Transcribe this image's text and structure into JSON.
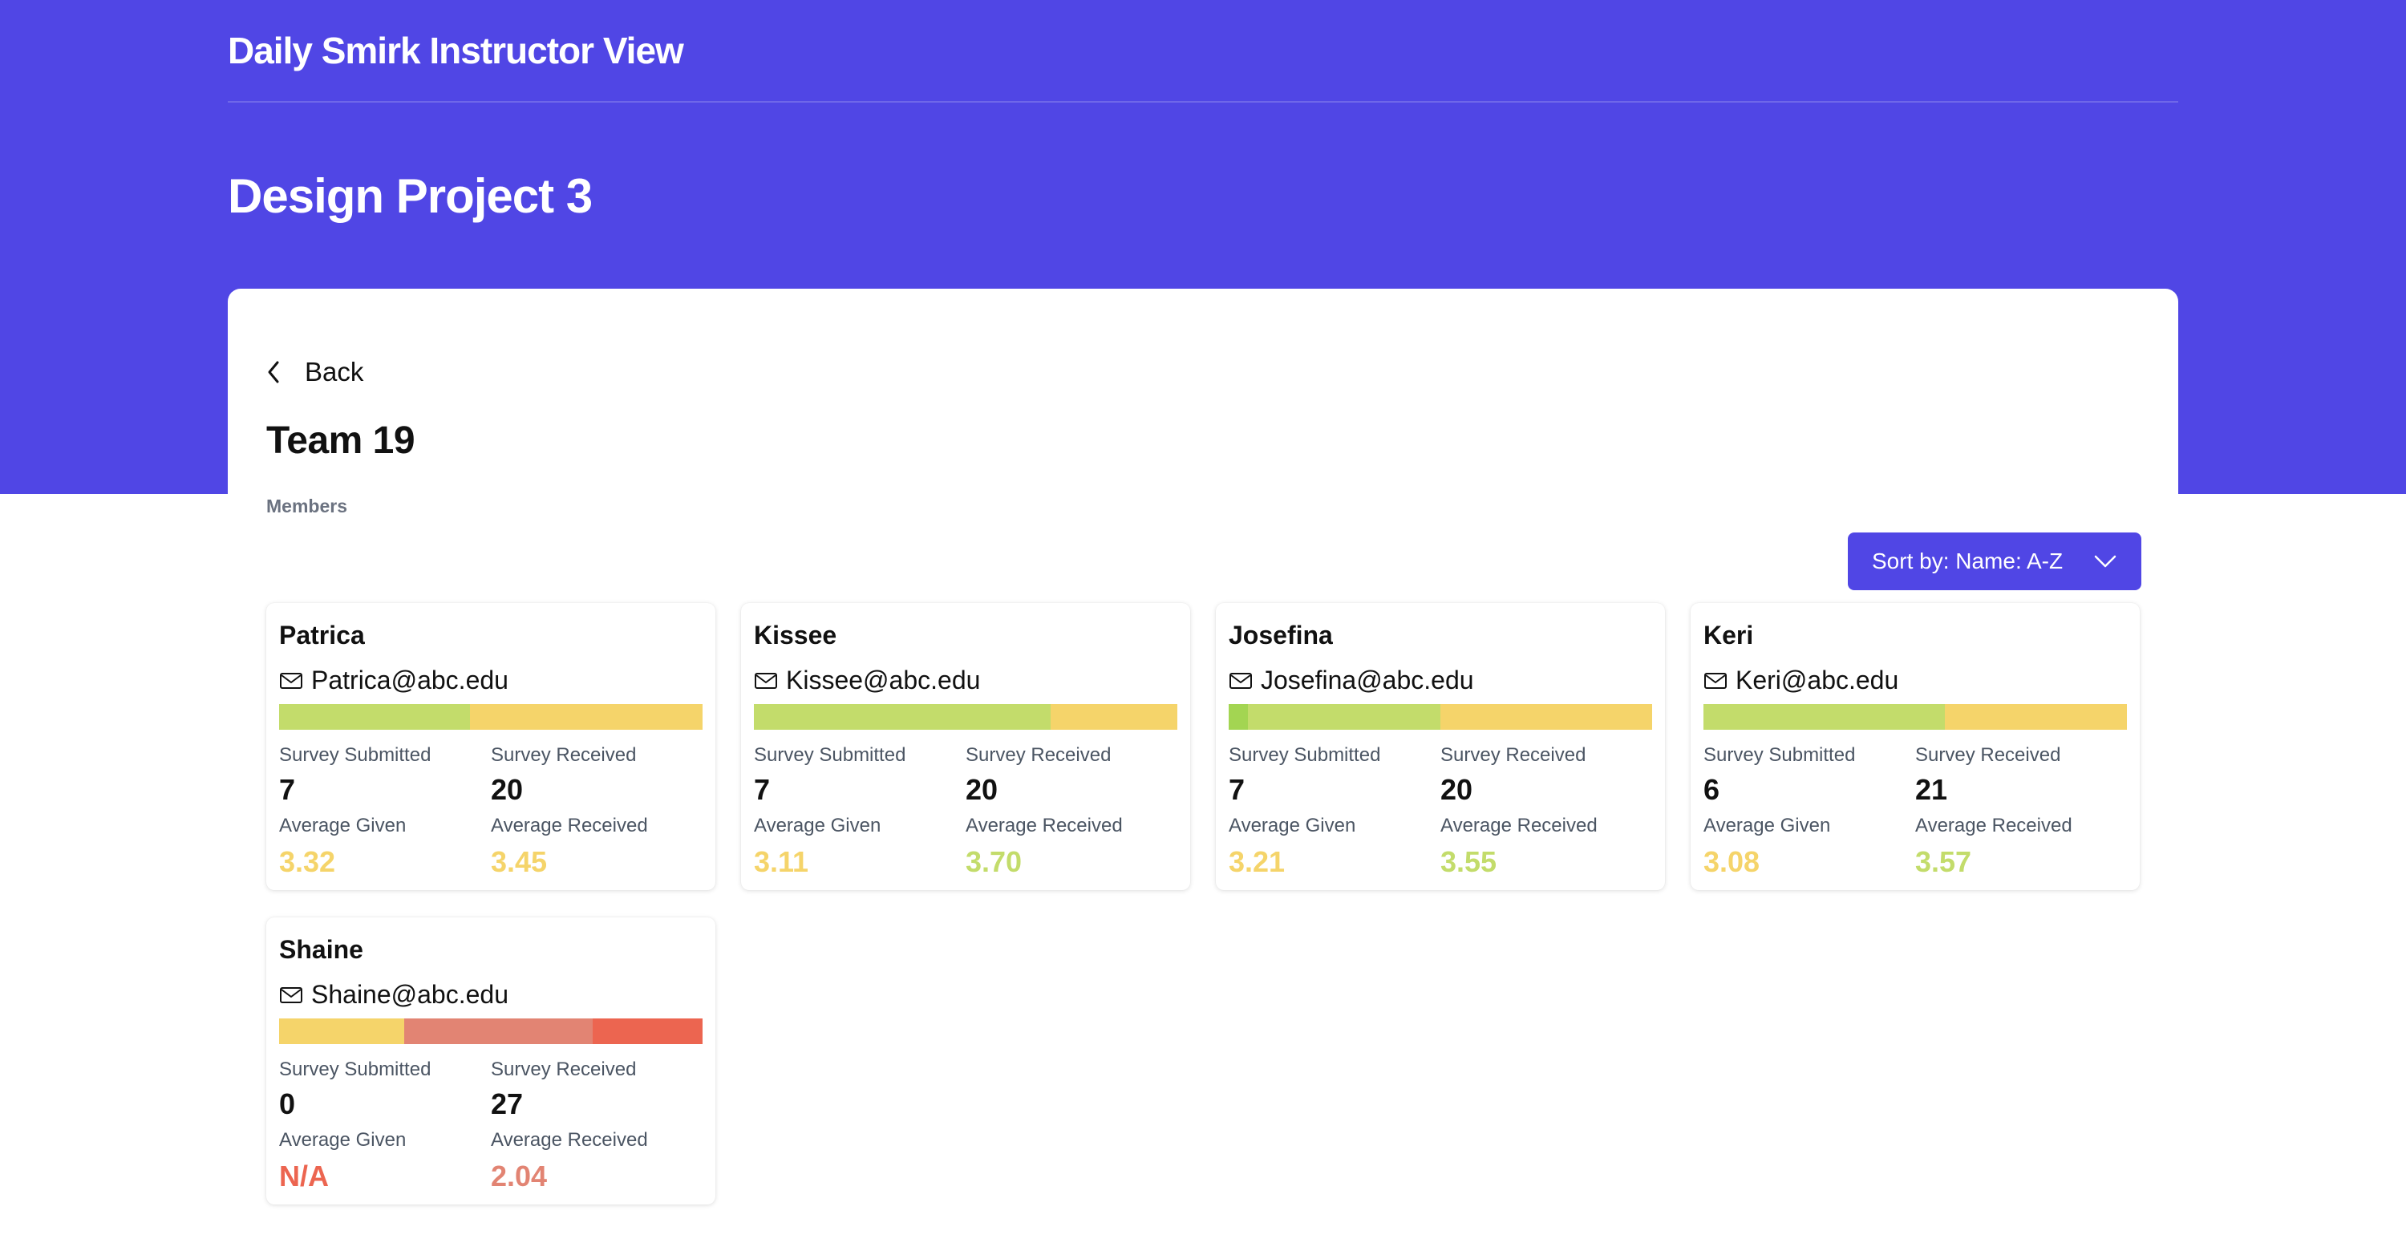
{
  "header": {
    "app_title": "Daily Smirk Instructor View",
    "project_title": "Design Project 3"
  },
  "panel": {
    "back_label": "Back",
    "team_title": "Team 19",
    "members_label": "Members",
    "sort_label": "Sort by: Name: A-Z"
  },
  "colors": {
    "brand": "#5046e5",
    "green": "#c3dc6b",
    "bright_green": "#a3d552",
    "yellow": "#f5d46a",
    "salmon": "#e28473",
    "red": "#ec6550"
  },
  "labels": {
    "survey_submitted": "Survey Submitted",
    "survey_received": "Survey Received",
    "average_given": "Average Given",
    "average_received": "Average Received"
  },
  "members": [
    {
      "name": "Patrica",
      "email": "Patrica@abc.edu",
      "survey_submitted": "7",
      "survey_received": "20",
      "average_given": "3.32",
      "average_given_color": "#f5d46a",
      "average_received": "3.45",
      "average_received_color": "#f5d46a",
      "bar": [
        {
          "color": "#c3dc6b",
          "fraction": 0.45
        },
        {
          "color": "#f5d46a",
          "fraction": 0.55
        }
      ]
    },
    {
      "name": "Kissee",
      "email": "Kissee@abc.edu",
      "survey_submitted": "7",
      "survey_received": "20",
      "average_given": "3.11",
      "average_given_color": "#f5d46a",
      "average_received": "3.70",
      "average_received_color": "#c3dc6b",
      "bar": [
        {
          "color": "#c3dc6b",
          "fraction": 0.7
        },
        {
          "color": "#f5d46a",
          "fraction": 0.3
        }
      ]
    },
    {
      "name": "Josefina",
      "email": "Josefina@abc.edu",
      "survey_submitted": "7",
      "survey_received": "20",
      "average_given": "3.21",
      "average_given_color": "#f5d46a",
      "average_received": "3.55",
      "average_received_color": "#c3dc6b",
      "bar": [
        {
          "color": "#a3d552",
          "fraction": 0.045
        },
        {
          "color": "#c3dc6b",
          "fraction": 0.455
        },
        {
          "color": "#f5d46a",
          "fraction": 0.5
        }
      ]
    },
    {
      "name": "Keri",
      "email": "Keri@abc.edu",
      "survey_submitted": "6",
      "survey_received": "21",
      "average_given": "3.08",
      "average_given_color": "#f5d46a",
      "average_received": "3.57",
      "average_received_color": "#c3dc6b",
      "bar": [
        {
          "color": "#c3dc6b",
          "fraction": 0.57
        },
        {
          "color": "#f5d46a",
          "fraction": 0.43
        }
      ]
    },
    {
      "name": "Shaine",
      "email": "Shaine@abc.edu",
      "survey_submitted": "0",
      "survey_received": "27",
      "average_given": "N/A",
      "average_given_color": "#ec6550",
      "average_received": "2.04",
      "average_received_color": "#e28473",
      "bar": [
        {
          "color": "#f5d46a",
          "fraction": 0.295
        },
        {
          "color": "#e28473",
          "fraction": 0.445
        },
        {
          "color": "#ec6550",
          "fraction": 0.26
        }
      ]
    }
  ]
}
